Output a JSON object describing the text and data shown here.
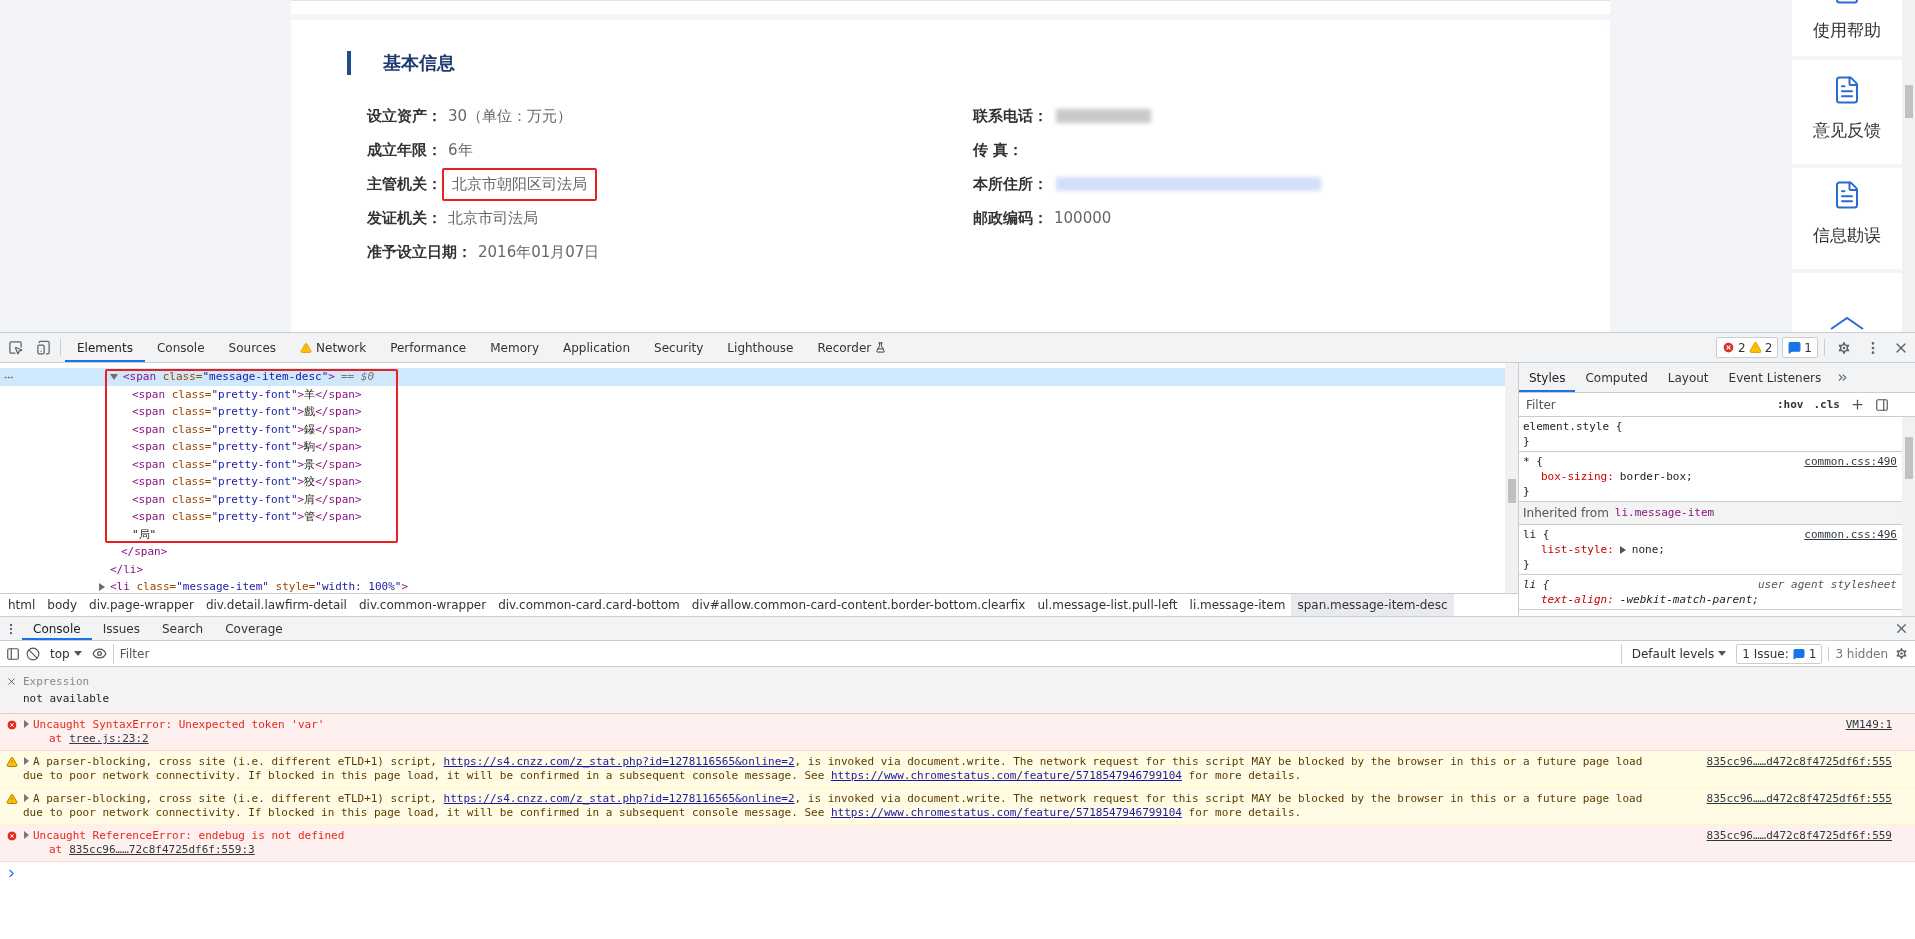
{
  "page": {
    "section_title": "基本信息",
    "left_fields": [
      {
        "label": "设立资产：",
        "value": "30（单位：万元）",
        "highlighted": false
      },
      {
        "label": "成立年限：",
        "value": "6年",
        "highlighted": false
      },
      {
        "label": "主管机关：",
        "value": "北京市朝阳区司法局",
        "highlighted": true
      },
      {
        "label": "发证机关：",
        "value": "北京市司法局",
        "highlighted": false
      },
      {
        "label": "准予设立日期：",
        "value": "2016年01月07日",
        "highlighted": false
      }
    ],
    "right_fields": [
      {
        "label": "联系电话：",
        "redacted": true
      },
      {
        "label": "传 真："
      },
      {
        "label": "本所住所：",
        "redacted": true
      },
      {
        "label": "邮政编码：",
        "value": "100000"
      }
    ]
  },
  "sidebar": {
    "items": [
      {
        "label": "使用帮助"
      },
      {
        "label": "意见反馈"
      },
      {
        "label": "信息勘误"
      }
    ]
  },
  "devtools": {
    "tabs": [
      {
        "label": "Elements",
        "selected": true,
        "kind": "plain"
      },
      {
        "label": "Console",
        "selected": false,
        "kind": "plain"
      },
      {
        "label": "Sources",
        "selected": false,
        "kind": "plain"
      },
      {
        "label": "Network",
        "selected": false,
        "kind": "warning"
      },
      {
        "label": "Performance",
        "selected": false,
        "kind": "plain"
      },
      {
        "label": "Memory",
        "selected": false,
        "kind": "plain"
      },
      {
        "label": "Application",
        "selected": false,
        "kind": "plain"
      },
      {
        "label": "Security",
        "selected": false,
        "kind": "plain"
      },
      {
        "label": "Lighthouse",
        "selected": false,
        "kind": "plain"
      },
      {
        "label": "Recorder",
        "selected": false,
        "kind": "experimental"
      }
    ],
    "counters": {
      "errors": "2",
      "warnings": "2",
      "issues": "1"
    }
  },
  "elements": {
    "tree": [
      {
        "close": "</li>",
        "children": [
          {
            "text": "<span class=\"message-item-desc\">",
            "note": "== $0",
            "selected": true,
            "expanded": true,
            "highlighted": true,
            "close": "</span>",
            "children": [
              {
                "text": "<span class=\"pretty-font\">羊</span>",
                "selected": false
              },
              {
                "text": "<span class=\"pretty-font\">戲</span>",
                "selected": false
              },
              {
                "text": "<span class=\"pretty-font\">鑤</span>",
                "selected": false
              },
              {
                "text": "<span class=\"pretty-font\">駒</span>",
                "selected": false
              },
              {
                "text": "<span class=\"pretty-font\">㬌</span>",
                "selected": false
              },
              {
                "text": "<span class=\"pretty-font\">狡</span>",
                "selected": false
              },
              {
                "text": "<span class=\"pretty-font\">肩</span>",
                "selected": false
              },
              {
                "text": "<span class=\"pretty-font\">管</span>",
                "selected": false
              },
              {
                "kind": "text",
                "text": "\"局\"",
                "selected": false
              }
            ]
          }
        ]
      },
      {
        "text": "<li class=\"message-item\" style=\"width: 100%\">",
        "expanded": false,
        "selected": false
      }
    ],
    "breadcrumb": [
      {
        "label": "html",
        "selected": false
      },
      {
        "label": "body",
        "selected": false
      },
      {
        "label": "div.page-wrapper",
        "selected": false
      },
      {
        "label": "div.detail.lawfirm-detail",
        "selected": false
      },
      {
        "label": "div.common-wrapper",
        "selected": false
      },
      {
        "label": "div.common-card.card-bottom",
        "selected": false
      },
      {
        "label": "div#allow.common-card-content.border-bottom.clearfix",
        "selected": false
      },
      {
        "label": "ul.message-list.pull-left",
        "selected": false
      },
      {
        "label": "li.message-item",
        "selected": false
      },
      {
        "label": "span.message-item-desc",
        "selected": true
      }
    ]
  },
  "styles": {
    "tabs": [
      {
        "label": "Styles",
        "selected": true
      },
      {
        "label": "Computed",
        "selected": false
      },
      {
        "label": "Layout",
        "selected": false
      },
      {
        "label": "Event Listeners",
        "selected": false
      }
    ],
    "filter_placeholder": "Filter",
    "hov": ":hov",
    "cls": ".cls",
    "rules": [
      {
        "kind": "rule",
        "selector": "element.style {",
        "close": "}"
      },
      {
        "kind": "rule",
        "selector": "* {",
        "source": "common.css:490",
        "declarations": [
          {
            "property": "box-sizing:",
            "value": "border-box;",
            "expandable": false
          }
        ],
        "close": "}"
      },
      {
        "kind": "inherited",
        "prefix": "Inherited from",
        "selector": "li.message-item"
      },
      {
        "kind": "rule",
        "selector": "li {",
        "source": "common.css:496",
        "declarations": [
          {
            "property": "list-style:",
            "value": "none;",
            "expandable": true
          }
        ],
        "close": "}"
      },
      {
        "kind": "user-agent",
        "selector": "li {",
        "source": "user agent stylesheet",
        "declarations": [
          {
            "property": "text-align:",
            "value": "-webkit-match-parent;",
            "expandable": false
          }
        ]
      }
    ]
  },
  "console": {
    "tabs": [
      {
        "label": "Console",
        "selected": true
      },
      {
        "label": "Issues",
        "selected": false
      },
      {
        "label": "Search",
        "selected": false
      },
      {
        "label": "Coverage",
        "selected": false
      }
    ],
    "context": "top",
    "filter_placeholder": "Filter",
    "levels": "Default levels",
    "issues_label": "1 Issue:",
    "issues_count": "1",
    "hidden": "3 hidden",
    "expression": {
      "placeholder": "Expression",
      "value": "not available"
    },
    "messages": [
      {
        "kind": "error",
        "parts": [
          {
            "text": "Uncaught SyntaxError: Unexpected token 'var'"
          }
        ],
        "trace": {
          "prefix": "at",
          "link": "tree.js:23:2"
        },
        "source": "VM149:1"
      },
      {
        "kind": "warning",
        "parts": [
          {
            "text": "A parser-blocking, cross site (i.e. different eTLD+1) script, "
          },
          {
            "link": "https://s4.cnzz.com/z_stat.php?id=1278116565&online=2"
          },
          {
            "text": ", is invoked via document.write. The network request for this script MAY be blocked by the browser in this or a future page load due to poor network connectivity. If blocked in this page load, it will be confirmed in a subsequent console message. See "
          },
          {
            "link": "https://www.chromestatus.com/feature/5718547946799104"
          },
          {
            "text": " for more details."
          }
        ],
        "source": "835cc96……d472c8f4725df6f:555"
      },
      {
        "kind": "warning",
        "parts": [
          {
            "text": "A parser-blocking, cross site (i.e. different eTLD+1) script, "
          },
          {
            "link": "https://s4.cnzz.com/z_stat.php?id=1278116565&online=2"
          },
          {
            "text": ", is invoked via document.write. The network request for this script MAY be blocked by the browser in this or a future page load due to poor network connectivity. If blocked in this page load, it will be confirmed in a subsequent console message. See "
          },
          {
            "link": "https://www.chromestatus.com/feature/5718547946799104"
          },
          {
            "text": " for more details."
          }
        ],
        "source": "835cc96……d472c8f4725df6f:555"
      },
      {
        "kind": "error",
        "parts": [
          {
            "text": "Uncaught ReferenceError: endebug is not defined"
          }
        ],
        "trace": {
          "prefix": "at",
          "link": "835cc96……72c8f4725df6f:559:3"
        },
        "source": "835cc96……d472c8f4725df6f:559"
      }
    ]
  }
}
